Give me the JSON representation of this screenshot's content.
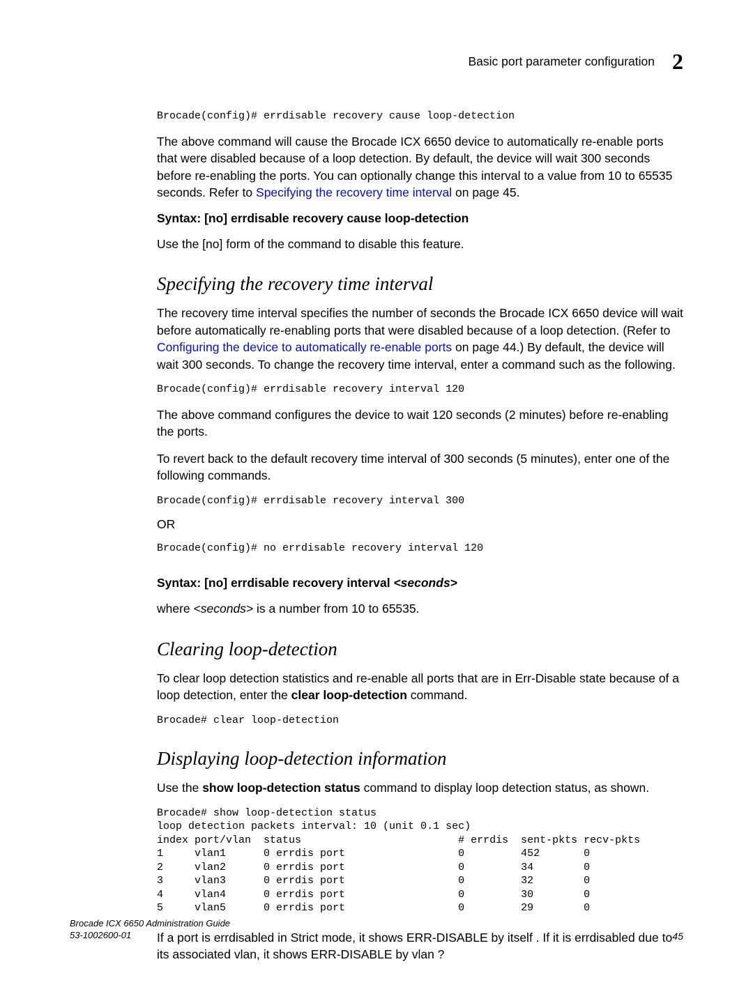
{
  "header": {
    "section_title": "Basic port parameter configuration",
    "chapter_number": "2"
  },
  "para1_code": "Brocade(config)# errdisable recovery cause loop-detection",
  "para2_a": "The above command will cause the Brocade ICX 6650 device to automatically re-enable ports that were disabled because of a loop detection.   By default, the device will wait 300 seconds before re-enabling the ports.  You can optionally change this interval to a value from 10 to 65535 seconds.  Refer to ",
  "para2_link": "Specifying the recovery time interval",
  "para2_b": " on page 45.",
  "syntax1": "Syntax: [no] errdisable recovery cause loop-detection",
  "para3": "Use the [no] form of the command to disable this feature.",
  "heading1": "Specifying the recovery time interval",
  "para4_a": "The recovery time interval specifies the number of seconds the Brocade ICX 6650 device will wait before automatically re-enabling ports that were disabled because of a loop detection.  (Refer to ",
  "para4_link": "Configuring the device to automatically re-enable ports",
  "para4_b": " on page 44.)  By default, the device will wait 300 seconds.  To change the recovery time interval, enter a command such as the following.",
  "code2": "Brocade(config)# errdisable recovery interval 120",
  "para5": "The above command configures the device to wait 120 seconds (2 minutes) before re-enabling the ports.",
  "para6": "To revert back to the default recovery time interval of 300 seconds (5 minutes), enter one of the following commands.",
  "code3": "Brocade(config)# errdisable recovery interval 300",
  "or_text": "OR",
  "code4": "Brocade(config)# no errdisable recovery interval 120",
  "syntax2_a": "Syntax: [no] errdisable recovery interval ",
  "syntax2_b": "<seconds>",
  "para7_a": "where ",
  "para7_b": "<seconds>",
  "para7_c": "  is a number from 10 to 65535.",
  "heading2": "Clearing loop-detection",
  "para8_a": "To clear loop detection statistics and re-enable all ports that are in Err-Disable state because of a loop detection, enter the ",
  "para8_b": "clear loop-detection",
  "para8_c": " command.",
  "code5": "Brocade# clear loop-detection",
  "heading3": "Displaying loop-detection information",
  "para9_a": "Use the ",
  "para9_b": "show loop-detection status",
  "para9_c": " command to display loop detection status, as shown.",
  "code6": "Brocade# show loop-detection status\nloop detection packets interval: 10 (unit 0.1 sec)\nindex port/vlan  status                         # errdis  sent-pkts recv-pkts\n1     vlan1      0 errdis port                  0         452       0\n2     vlan2      0 errdis port                  0         34        0\n3     vlan3      0 errdis port                  0         32        0\n4     vlan4      0 errdis port                  0         30        0\n5     vlan5      0 errdis port                  0         29        0",
  "para10": "If a port is errdisabled in Strict mode, it shows  ERR-DISABLE by itself .  If it is errdisabled due to its associated vlan, it shows  ERR-DISABLE by vlan ?",
  "footer": {
    "guide": "Brocade ICX 6650 Administration Guide",
    "docnum": "53-1002600-01",
    "page": "45"
  },
  "chart_data": {
    "type": "table",
    "title": "show loop-detection status output",
    "columns": [
      "index",
      "port/vlan",
      "status",
      "# errdis",
      "sent-pkts",
      "recv-pkts"
    ],
    "rows": [
      [
        1,
        "vlan1",
        "0 errdis port",
        0,
        452,
        0
      ],
      [
        2,
        "vlan2",
        "0 errdis port",
        0,
        34,
        0
      ],
      [
        3,
        "vlan3",
        "0 errdis port",
        0,
        32,
        0
      ],
      [
        4,
        "vlan4",
        "0 errdis port",
        0,
        30,
        0
      ],
      [
        5,
        "vlan5",
        "0 errdis port",
        0,
        29,
        0
      ]
    ],
    "interval_note": "loop detection packets interval: 10 (unit 0.1 sec)"
  }
}
